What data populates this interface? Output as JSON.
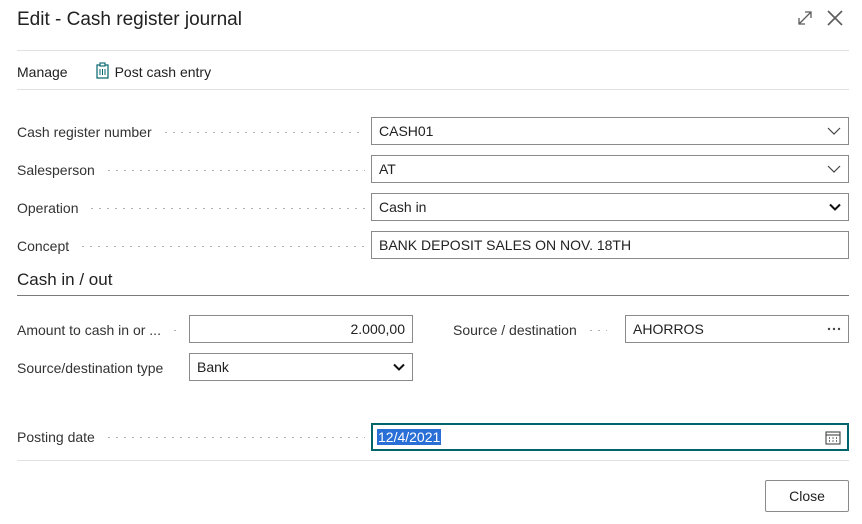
{
  "dialog": {
    "title": "Edit - Cash register journal"
  },
  "toolbar": {
    "manage_label": "Manage",
    "post_label": "Post cash entry"
  },
  "fields": {
    "cash_register_number": {
      "label": "Cash register number",
      "value": "CASH01"
    },
    "salesperson": {
      "label": "Salesperson",
      "value": "AT"
    },
    "operation": {
      "label": "Operation",
      "value": "Cash in"
    },
    "concept": {
      "label": "Concept",
      "value": "BANK DEPOSIT SALES ON NOV. 18TH"
    }
  },
  "cash_section": {
    "title": "Cash in / out",
    "amount": {
      "label": "Amount to cash in or ...",
      "value": "2.000,00"
    },
    "source_destination": {
      "label": "Source / destination",
      "value": "AHORROS"
    },
    "source_destination_type": {
      "label": "Source/destination type",
      "value": "Bank"
    }
  },
  "posting": {
    "label": "Posting date",
    "value": "12/4/2021"
  },
  "footer": {
    "close_label": "Close"
  },
  "colors": {
    "accent": "#00656b",
    "selection": "#2a6fd6",
    "icon": "#00656b"
  }
}
